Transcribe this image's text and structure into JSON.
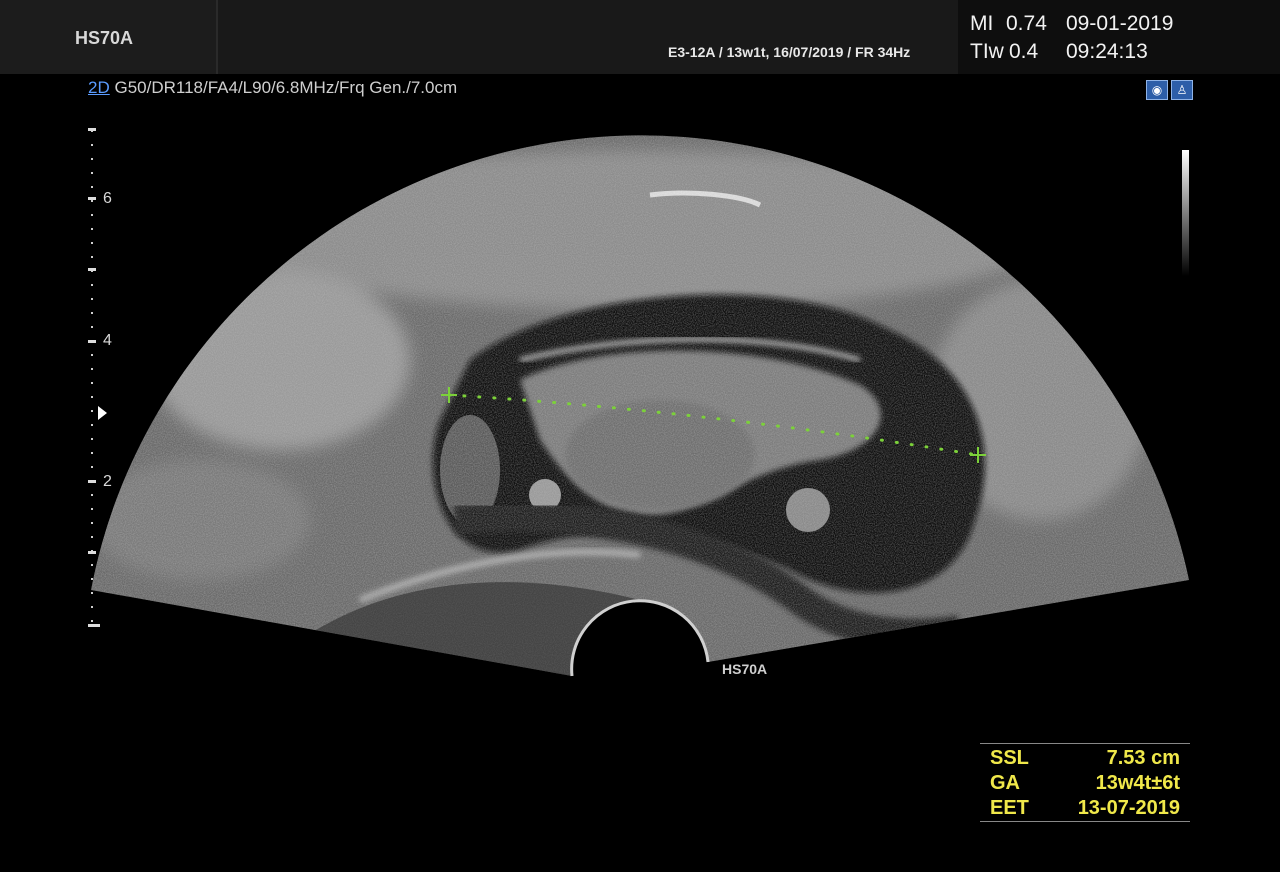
{
  "header": {
    "device": "HS70A",
    "probe_info": "E3-12A / 13w1t, 16/07/2019 / FR 34Hz",
    "mi_label": "MI",
    "mi_value": "0.74",
    "tib_label": "TIw",
    "tib_value": "0.4",
    "date": "09-01-2019",
    "time": "09:24:13"
  },
  "params": {
    "mode": "2D",
    "settings": "G50/DR118/FA4/L90/6.8MHz/Frq Gen./7.0cm"
  },
  "depth_labels": [
    "6",
    "4",
    "2"
  ],
  "watermark": "HS70A",
  "measurements": [
    {
      "key": "SSL",
      "value": "7.53 cm"
    },
    {
      "key": "GA",
      "value": "13w4t±6t"
    },
    {
      "key": "EET",
      "value": "13-07-2019"
    }
  ],
  "colors": {
    "measurement": "#f0e84a",
    "caliper": "#7cd13a",
    "mode": "#5b9cff"
  },
  "icon_names": [
    "fetus-icon",
    "mother-icon"
  ]
}
